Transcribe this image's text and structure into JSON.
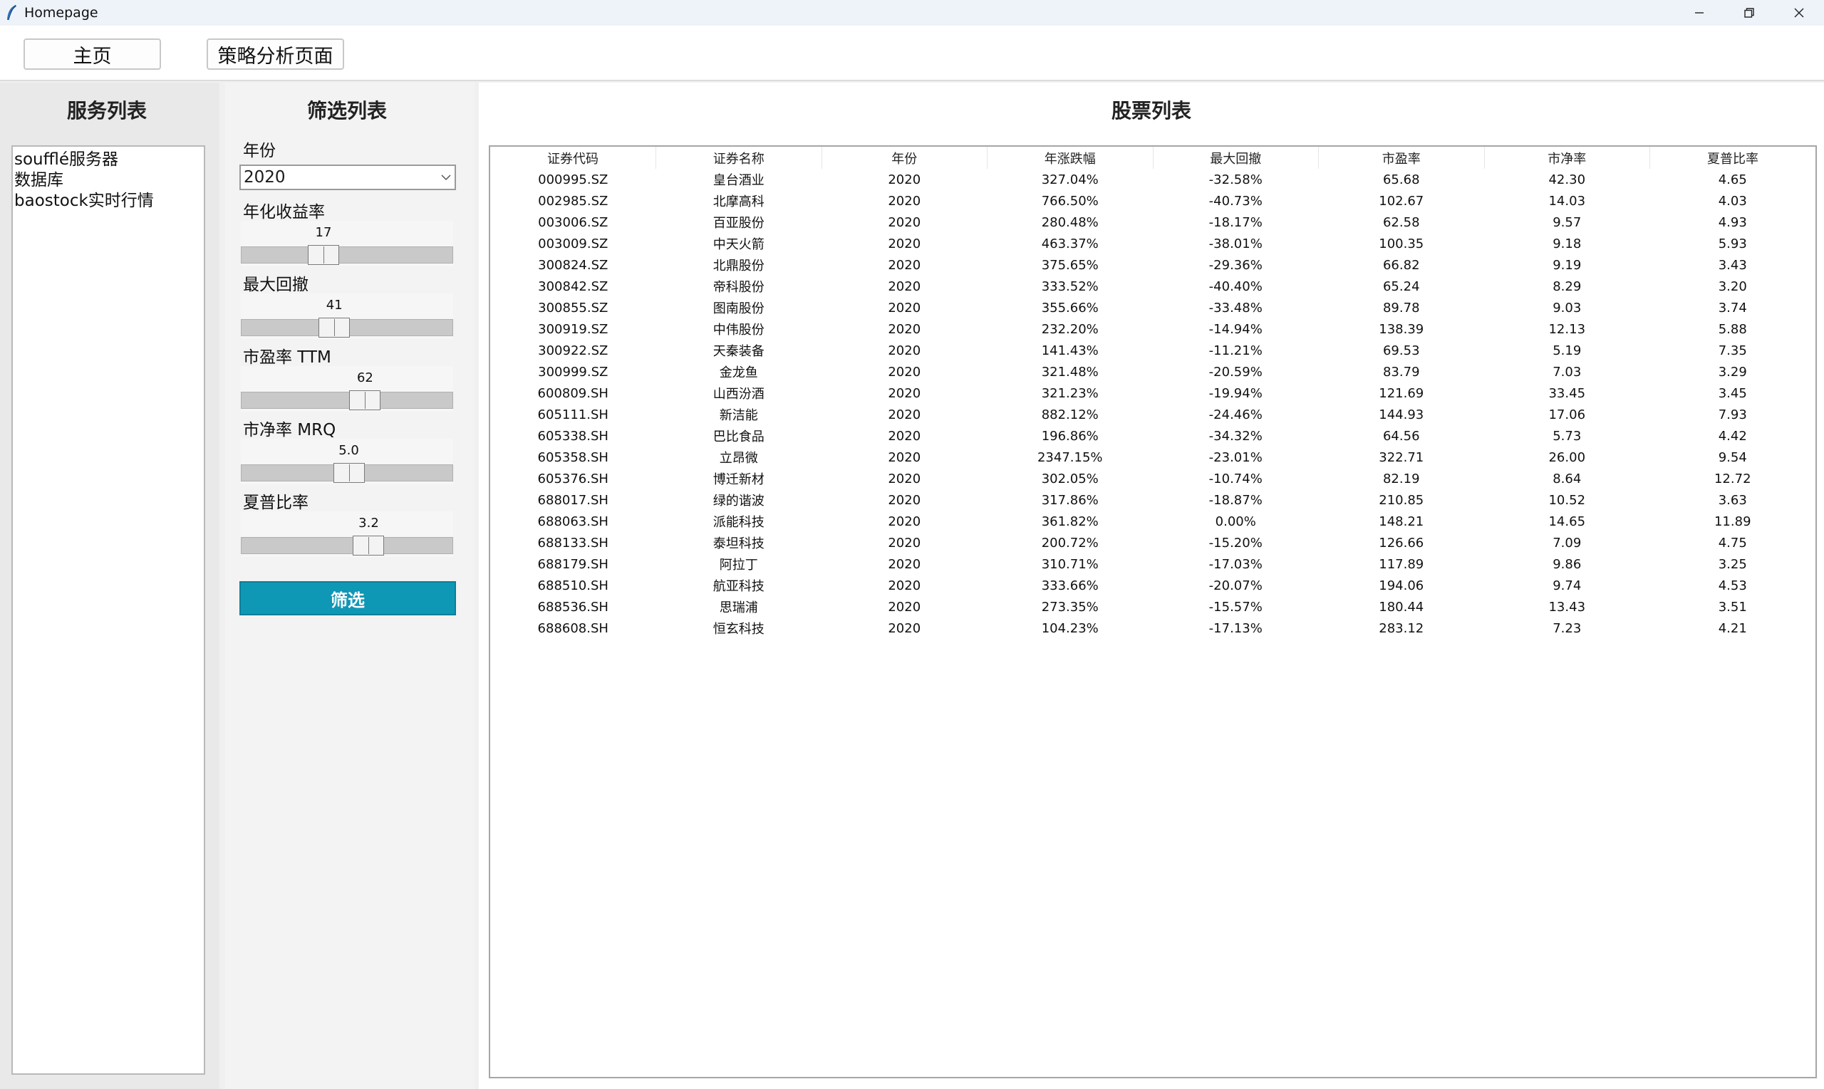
{
  "window": {
    "title": "Homepage",
    "app_icon": "feather-icon"
  },
  "nav": {
    "home_label": "主页",
    "strategy_label": "策略分析页面"
  },
  "services": {
    "heading": "服务列表",
    "items": [
      "soufflé服务器",
      "数据库",
      "baostock实时行情"
    ]
  },
  "filters": {
    "heading": "筛选列表",
    "year_label": "年份",
    "year_value": "2020",
    "annual_return": {
      "label": "年化收益率",
      "value": "17",
      "fraction": 0.37
    },
    "max_drawdown": {
      "label": "最大回撤",
      "value": "41",
      "fraction": 0.43
    },
    "pe_ttm": {
      "label": "市盈率 TTM",
      "value": "62",
      "fraction": 0.6
    },
    "pb_mrq": {
      "label": "市净率 MRQ",
      "value": "5.0",
      "fraction": 0.51
    },
    "sharpe": {
      "label": "夏普比率",
      "value": "3.2",
      "fraction": 0.62
    },
    "button_label": "筛选"
  },
  "stocks": {
    "heading": "股票列表",
    "columns": [
      "证券代码",
      "证券名称",
      "年份",
      "年涨跌幅",
      "最大回撤",
      "市盈率",
      "市净率",
      "夏普比率"
    ],
    "rows": [
      [
        "000995.SZ",
        "皇台酒业",
        "2020",
        "327.04%",
        "-32.58%",
        "65.68",
        "42.30",
        "4.65"
      ],
      [
        "002985.SZ",
        "北摩高科",
        "2020",
        "766.50%",
        "-40.73%",
        "102.67",
        "14.03",
        "4.03"
      ],
      [
        "003006.SZ",
        "百亚股份",
        "2020",
        "280.48%",
        "-18.17%",
        "62.58",
        "9.57",
        "4.93"
      ],
      [
        "003009.SZ",
        "中天火箭",
        "2020",
        "463.37%",
        "-38.01%",
        "100.35",
        "9.18",
        "5.93"
      ],
      [
        "300824.SZ",
        "北鼎股份",
        "2020",
        "375.65%",
        "-29.36%",
        "66.82",
        "9.19",
        "3.43"
      ],
      [
        "300842.SZ",
        "帝科股份",
        "2020",
        "333.52%",
        "-40.40%",
        "65.24",
        "8.29",
        "3.20"
      ],
      [
        "300855.SZ",
        "图南股份",
        "2020",
        "355.66%",
        "-33.48%",
        "89.78",
        "9.03",
        "3.74"
      ],
      [
        "300919.SZ",
        "中伟股份",
        "2020",
        "232.20%",
        "-14.94%",
        "138.39",
        "12.13",
        "5.88"
      ],
      [
        "300922.SZ",
        "天秦装备",
        "2020",
        "141.43%",
        "-11.21%",
        "69.53",
        "5.19",
        "7.35"
      ],
      [
        "300999.SZ",
        "金龙鱼",
        "2020",
        "321.48%",
        "-20.59%",
        "83.79",
        "7.03",
        "3.29"
      ],
      [
        "600809.SH",
        "山西汾酒",
        "2020",
        "321.23%",
        "-19.94%",
        "121.69",
        "33.45",
        "3.45"
      ],
      [
        "605111.SH",
        "新洁能",
        "2020",
        "882.12%",
        "-24.46%",
        "144.93",
        "17.06",
        "7.93"
      ],
      [
        "605338.SH",
        "巴比食品",
        "2020",
        "196.86%",
        "-34.32%",
        "64.56",
        "5.73",
        "4.42"
      ],
      [
        "605358.SH",
        "立昂微",
        "2020",
        "2347.15%",
        "-23.01%",
        "322.71",
        "26.00",
        "9.54"
      ],
      [
        "605376.SH",
        "博迁新材",
        "2020",
        "302.05%",
        "-10.74%",
        "82.19",
        "8.64",
        "12.72"
      ],
      [
        "688017.SH",
        "绿的谐波",
        "2020",
        "317.86%",
        "-18.87%",
        "210.85",
        "10.52",
        "3.63"
      ],
      [
        "688063.SH",
        "派能科技",
        "2020",
        "361.82%",
        "0.00%",
        "148.21",
        "14.65",
        "11.89"
      ],
      [
        "688133.SH",
        "泰坦科技",
        "2020",
        "200.72%",
        "-15.20%",
        "126.66",
        "7.09",
        "4.75"
      ],
      [
        "688179.SH",
        "阿拉丁",
        "2020",
        "310.71%",
        "-17.03%",
        "117.89",
        "9.86",
        "3.25"
      ],
      [
        "688510.SH",
        "航亚科技",
        "2020",
        "333.66%",
        "-20.07%",
        "194.06",
        "9.74",
        "4.53"
      ],
      [
        "688536.SH",
        "思瑞浦",
        "2020",
        "273.35%",
        "-15.57%",
        "180.44",
        "13.43",
        "3.51"
      ],
      [
        "688608.SH",
        "恒玄科技",
        "2020",
        "104.23%",
        "-17.13%",
        "283.12",
        "7.23",
        "4.21"
      ]
    ]
  }
}
